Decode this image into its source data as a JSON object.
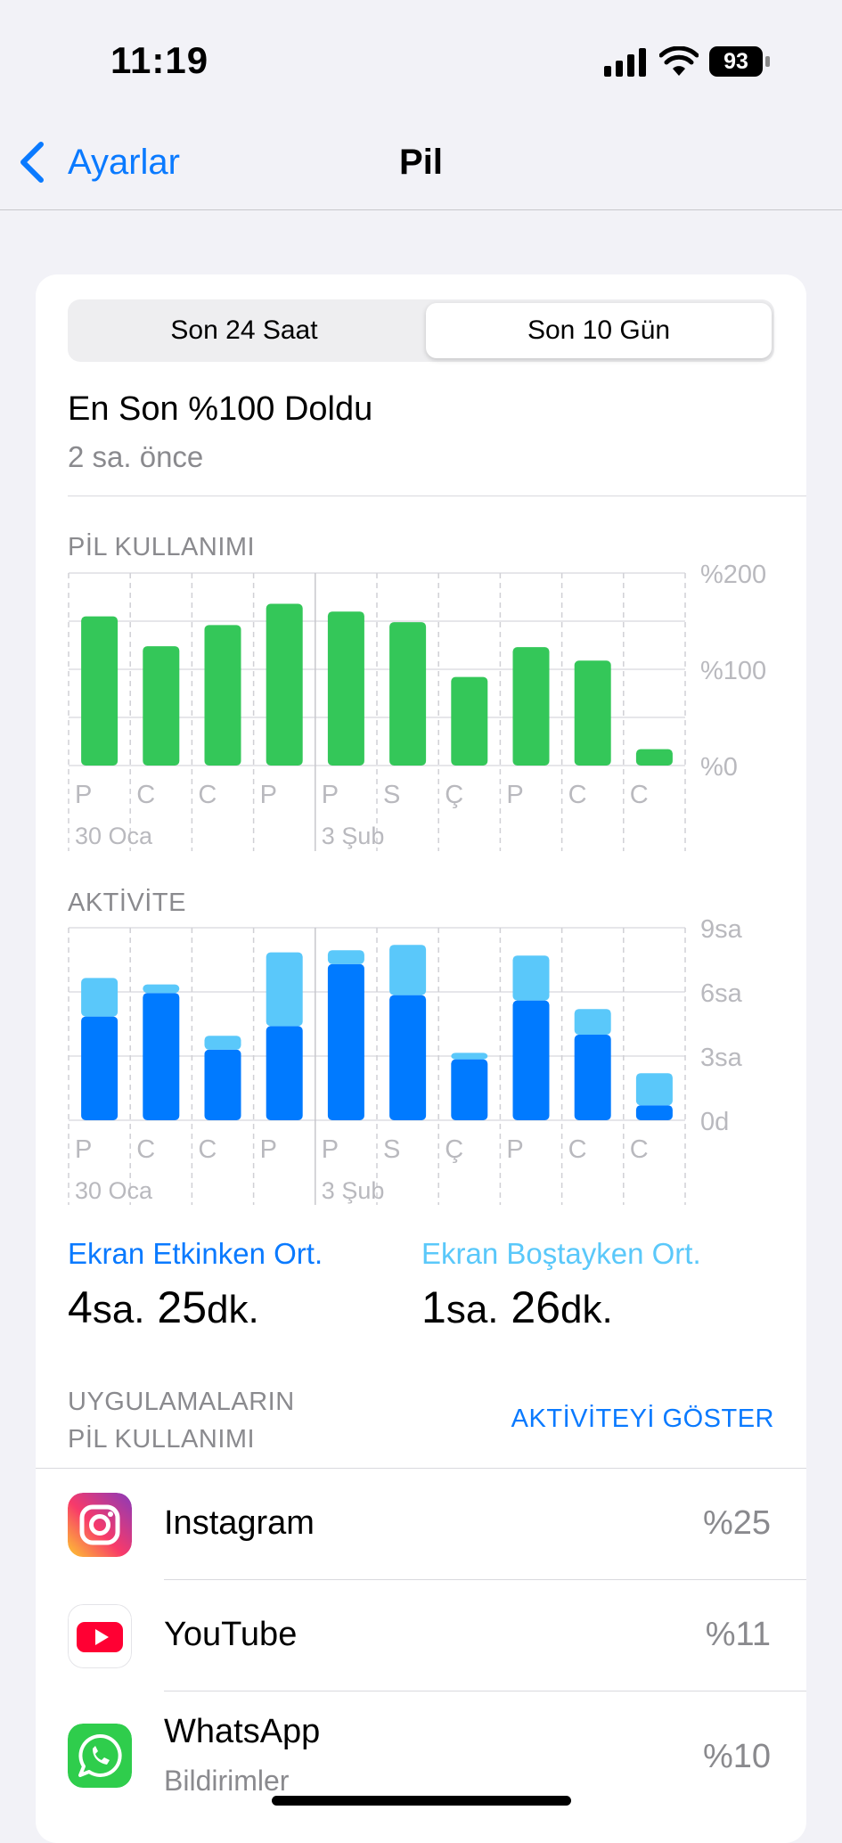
{
  "status": {
    "time": "11:19",
    "battery": "93"
  },
  "nav": {
    "back_label": "Ayarlar",
    "title": "Pil"
  },
  "segments": {
    "left": "Son 24 Saat",
    "right": "Son 10 Gün",
    "selected": "right"
  },
  "last_charge": {
    "title": "En Son %100 Doldu",
    "subtitle": "2 sa. önce"
  },
  "battery_usage": {
    "label": "PİL KULLANIMI"
  },
  "activity": {
    "label": "AKTİVİTE"
  },
  "chart_data": [
    {
      "type": "bar",
      "title": "PİL KULLANIMI",
      "categories": [
        "P",
        "C",
        "C",
        "P",
        "P",
        "S",
        "Ç",
        "P",
        "C",
        "C"
      ],
      "date_labels": [
        "30 Oca",
        "3 Şub"
      ],
      "y_ticks": [
        "%200",
        "%100",
        "%0"
      ],
      "ylim": [
        0,
        200
      ],
      "series": [
        {
          "values": [
            155,
            124,
            146,
            168,
            160,
            149,
            92,
            123,
            109,
            17
          ]
        }
      ],
      "colors": [
        "#34c759"
      ]
    },
    {
      "type": "bar",
      "title": "AKTİVİTE",
      "stacked": true,
      "categories": [
        "P",
        "C",
        "C",
        "P",
        "P",
        "S",
        "Ç",
        "P",
        "C",
        "C"
      ],
      "date_labels": [
        "30 Oca",
        "3 Şub"
      ],
      "y_ticks": [
        "9sa",
        "6sa",
        "3sa",
        "0d"
      ],
      "ylim": [
        0,
        9
      ],
      "series": [
        {
          "name": "Ekran Etkinken Ort.",
          "values": [
            4.85,
            5.95,
            3.3,
            4.4,
            7.3,
            5.85,
            2.85,
            5.6,
            4.0,
            0.7
          ]
        },
        {
          "name": "Ekran Boştayken Ort.",
          "values": [
            1.8,
            0.4,
            0.65,
            3.45,
            0.65,
            2.35,
            0.3,
            2.1,
            1.2,
            1.5
          ]
        }
      ],
      "colors": [
        "#007aff",
        "#5ac8fa"
      ]
    }
  ],
  "legend": {
    "active_label": "Ekran Etkinken Ort.",
    "active_hours": "4",
    "active_hours_unit": "sa.",
    "active_minutes": "25",
    "active_minutes_unit": "dk.",
    "idle_label": "Ekran Boştayken Ort.",
    "idle_hours": "1",
    "idle_hours_unit": "sa.",
    "idle_minutes": "26",
    "idle_minutes_unit": "dk."
  },
  "apps_section": {
    "header_line1": "UYGULAMALARIN",
    "header_line2": "PİL KULLANIMI",
    "show_activity": "AKTİVİTEYİ GÖSTER"
  },
  "apps": [
    {
      "name": "Instagram",
      "percent": "%25",
      "icon": "instagram-icon"
    },
    {
      "name": "YouTube",
      "percent": "%11",
      "icon": "youtube-icon"
    },
    {
      "name": "WhatsApp",
      "subtitle": "Bildirimler",
      "percent": "%10",
      "icon": "whatsapp-icon"
    }
  ]
}
